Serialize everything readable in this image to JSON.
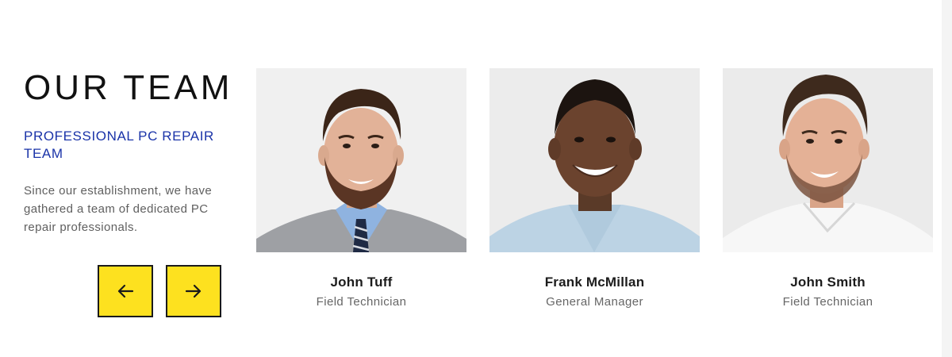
{
  "section": {
    "title": "OUR TEAM",
    "subtitle": "PROFESSIONAL PC REPAIR TEAM",
    "description": "Since our establishment, we have gathered a team of dedicated PC repair professionals."
  },
  "carousel": {
    "prev_icon": "arrow-left-icon",
    "next_icon": "arrow-right-icon"
  },
  "members": [
    {
      "name": "John Tuff",
      "role": "Field Technician"
    },
    {
      "name": "Frank McMillan",
      "role": "General Manager"
    },
    {
      "name": "John Smith",
      "role": "Field Technician"
    }
  ],
  "colors": {
    "accent_yellow": "#fde11f",
    "subtitle_blue": "#1a33a8",
    "title_dark": "#111111",
    "text_gray": "#5f5f5f"
  }
}
